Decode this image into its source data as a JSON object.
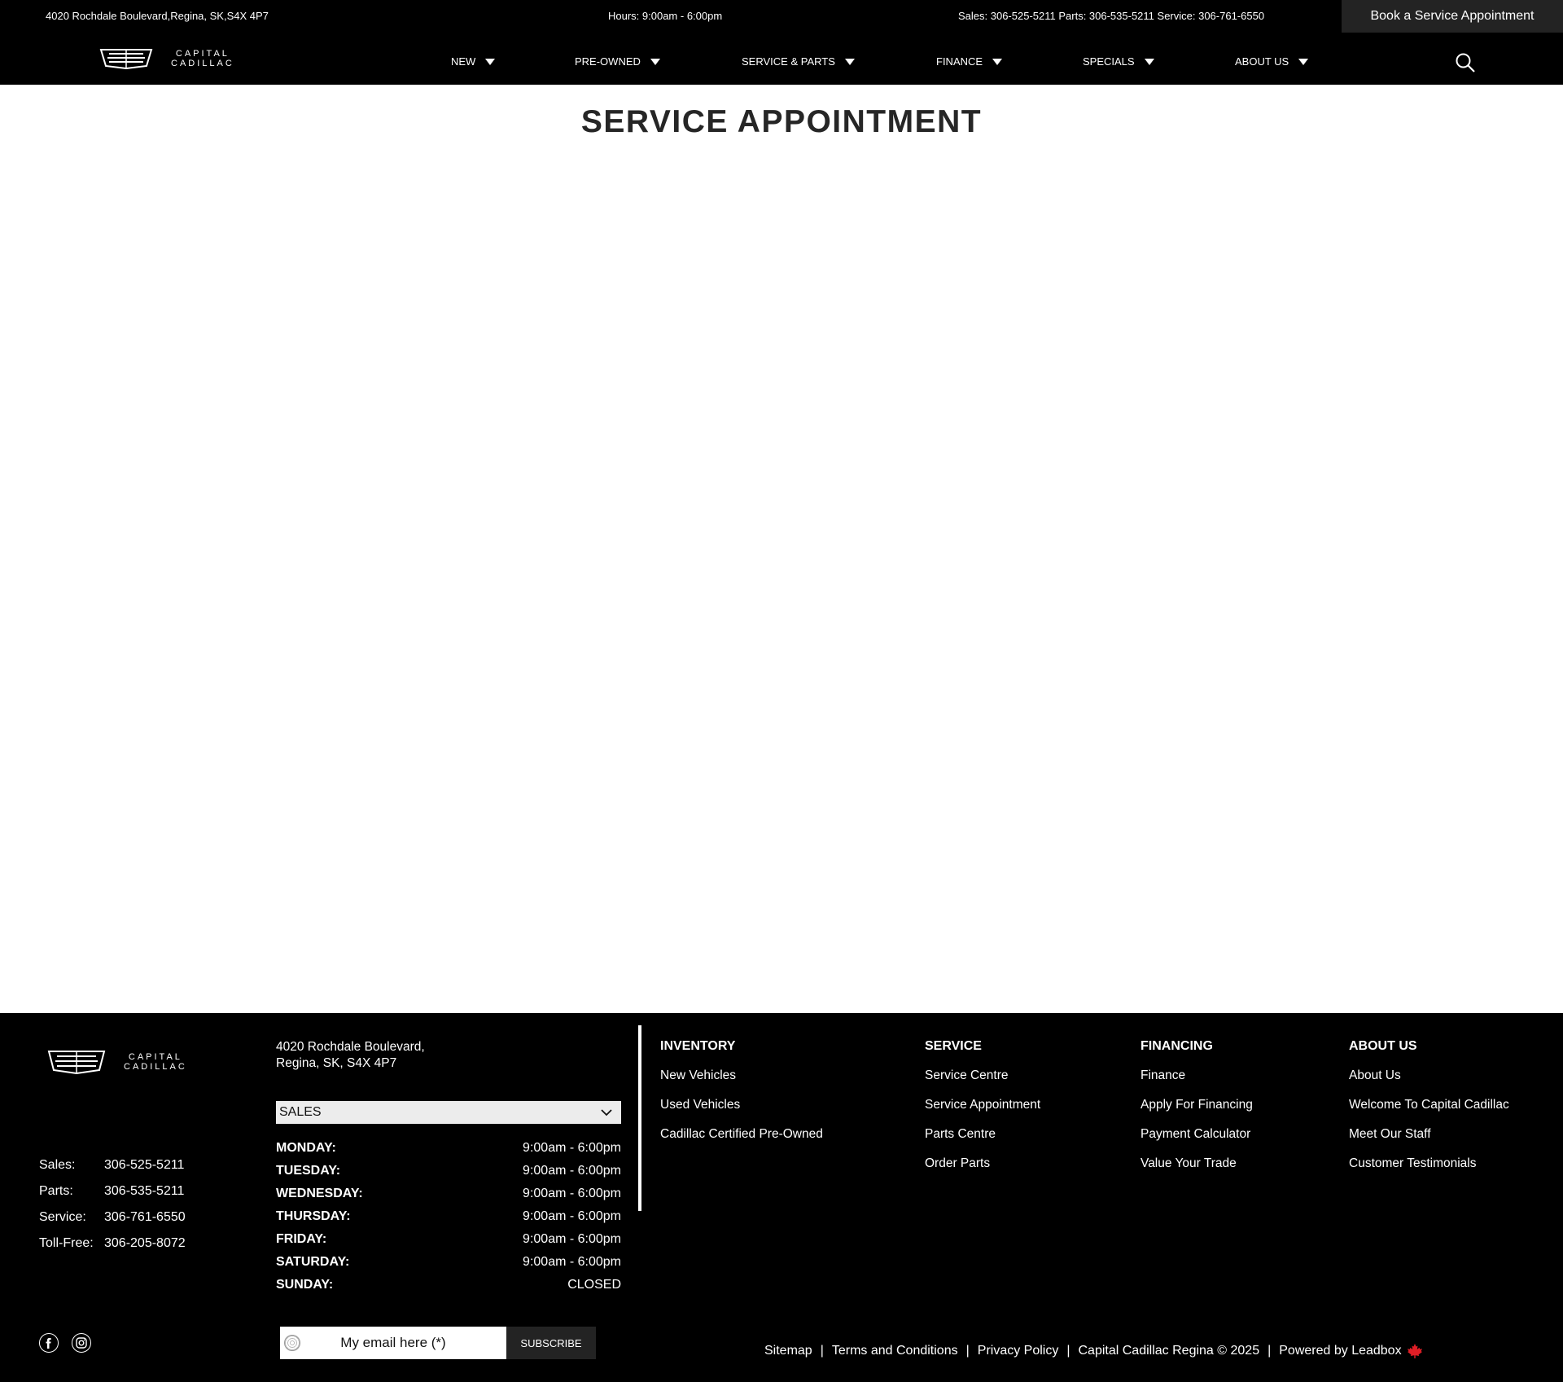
{
  "topbar": {
    "address": "4020 Rochdale Boulevard,Regina, SK,S4X 4P7",
    "hours": "Hours: 9:00am - 6:00pm",
    "phones": "Sales: 306-525-5211 Parts: 306-535-5211 Service: 306-761-6550",
    "book_button": "Book a Service Appointment"
  },
  "brand": {
    "line1": "CAPITAL",
    "line2": "CADILLAC"
  },
  "nav": {
    "items": [
      {
        "label": "NEW"
      },
      {
        "label": "PRE-OWNED"
      },
      {
        "label": "SERVICE & PARTS"
      },
      {
        "label": "FINANCE"
      },
      {
        "label": "SPECIALS"
      },
      {
        "label": "ABOUT US"
      }
    ],
    "search_icon": "search-icon"
  },
  "page": {
    "title": "SERVICE APPOINTMENT"
  },
  "footer": {
    "contacts": [
      {
        "label": "Sales:",
        "value": "306-525-5211"
      },
      {
        "label": "Parts:",
        "value": "306-535-5211"
      },
      {
        "label": "Service:",
        "value": "306-761-6550"
      },
      {
        "label": "Toll-Free:",
        "value": "306-205-8072"
      }
    ],
    "address_line1": "4020 Rochdale Boulevard,",
    "address_line2": "Regina, SK, S4X 4P7",
    "department_select": "SALES",
    "hours": [
      {
        "day": "MONDAY:",
        "time": "9:00am - 6:00pm"
      },
      {
        "day": "TUESDAY:",
        "time": "9:00am - 6:00pm"
      },
      {
        "day": "WEDNESDAY:",
        "time": "9:00am - 6:00pm"
      },
      {
        "day": "THURSDAY:",
        "time": "9:00am - 6:00pm"
      },
      {
        "day": "FRIDAY:",
        "time": "9:00am - 6:00pm"
      },
      {
        "day": "SATURDAY:",
        "time": "9:00am - 6:00pm"
      },
      {
        "day": "SUNDAY:",
        "time": "CLOSED"
      }
    ],
    "columns": [
      {
        "heading": "INVENTORY",
        "links": [
          "New Vehicles",
          "Used Vehicles",
          "Cadillac Certified Pre-Owned"
        ]
      },
      {
        "heading": "SERVICE",
        "links": [
          "Service Centre",
          "Service Appointment",
          "Parts Centre",
          "Order Parts"
        ]
      },
      {
        "heading": "FINANCING",
        "links": [
          "Finance",
          "Apply For Financing",
          "Payment Calculator",
          "Value Your Trade"
        ]
      },
      {
        "heading": "ABOUT US",
        "links": [
          "About Us",
          "Welcome To Capital Cadillac",
          "Meet Our Staff",
          "Customer Testimonials"
        ]
      }
    ],
    "social": [
      "facebook-icon",
      "instagram-icon"
    ],
    "subscribe": {
      "placeholder": "My email here (*)",
      "button": "SUBSCRIBE"
    },
    "legal": {
      "sitemap": "Sitemap",
      "terms": "Terms and Conditions",
      "privacy": "Privacy Policy",
      "copyright": "Capital Cadillac Regina © 2025",
      "powered": "Powered by Leadbox",
      "separator": "|"
    }
  }
}
